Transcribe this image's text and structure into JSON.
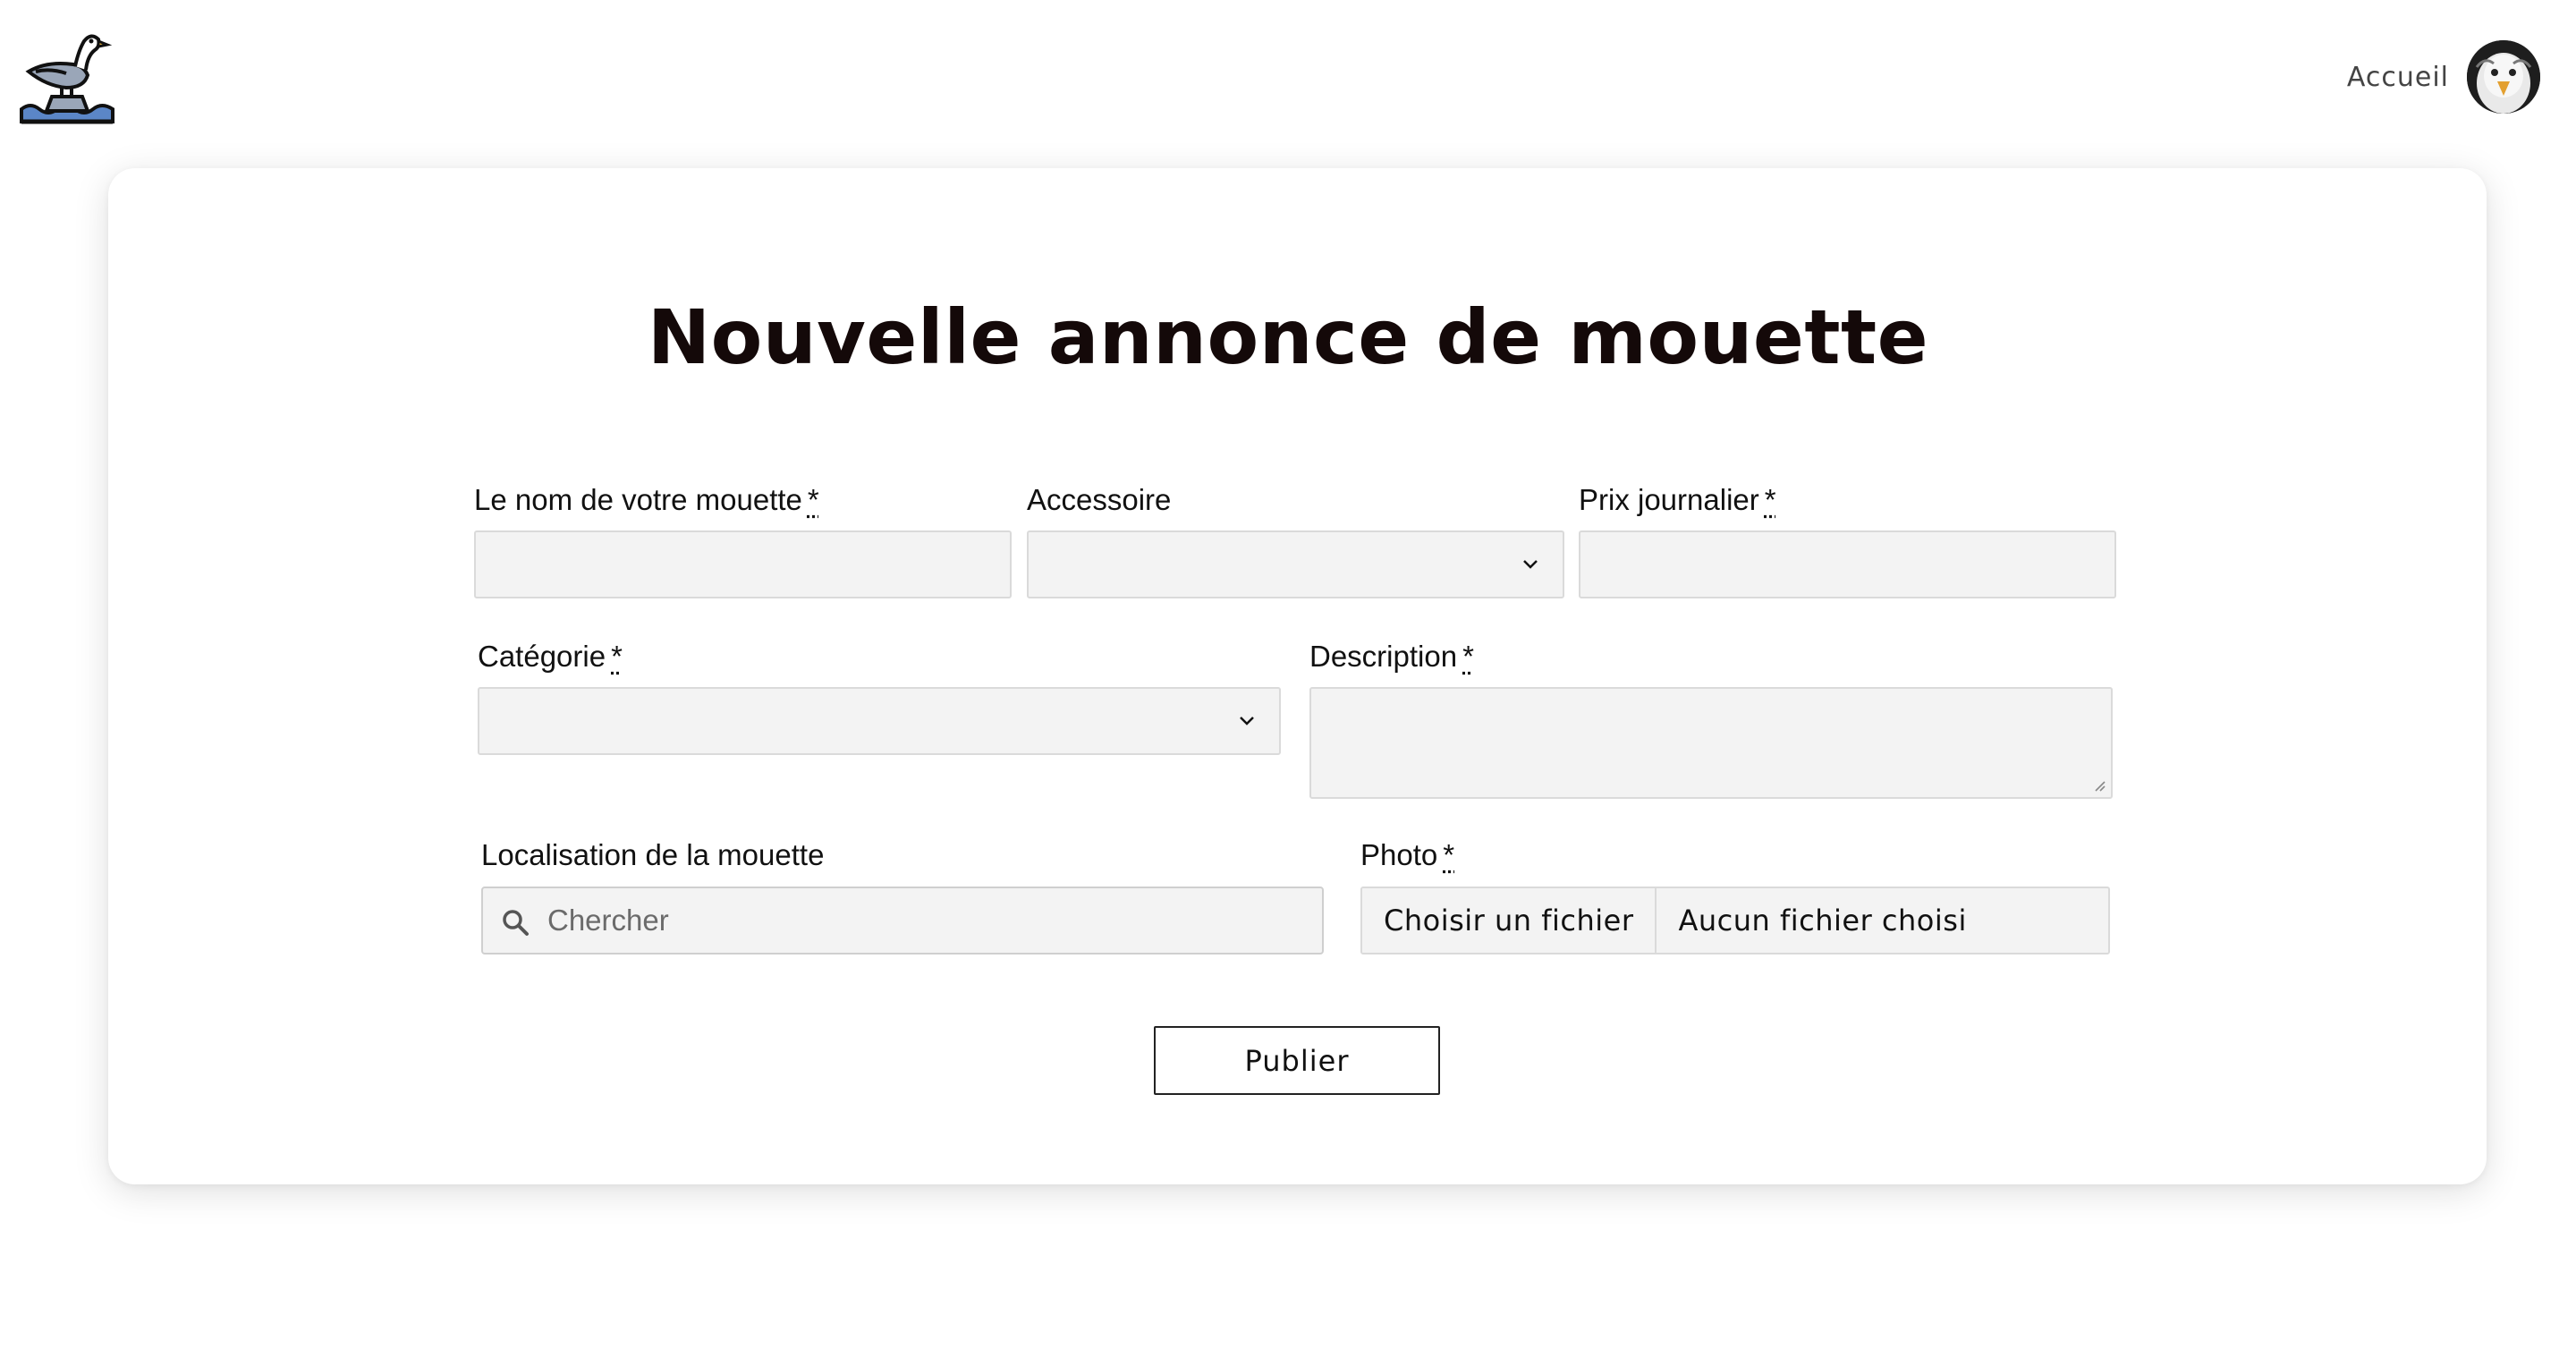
{
  "header": {
    "logo_icon": "seagull-on-rock-icon",
    "nav_link": "Accueil",
    "avatar_icon": "seagull-avatar-icon"
  },
  "form": {
    "title": "Nouvelle annonce de mouette",
    "required_marker": "*",
    "name": {
      "label": "Le nom de votre mouette",
      "value": ""
    },
    "accessory": {
      "label": "Accessoire",
      "selected": ""
    },
    "daily_price": {
      "label": "Prix journalier",
      "value": ""
    },
    "category": {
      "label": "Catégorie",
      "selected": ""
    },
    "description": {
      "label": "Description",
      "value": ""
    },
    "location": {
      "label": "Localisation de la mouette",
      "placeholder": "Chercher"
    },
    "photo": {
      "label": "Photo",
      "button_label": "Choisir un fichier",
      "status": "Aucun fichier choisi"
    },
    "submit_label": "Publier"
  },
  "colors": {
    "title": "#140909",
    "input_bg": "#f3f3f3",
    "input_border": "#dadada",
    "nav_text": "#444444"
  }
}
